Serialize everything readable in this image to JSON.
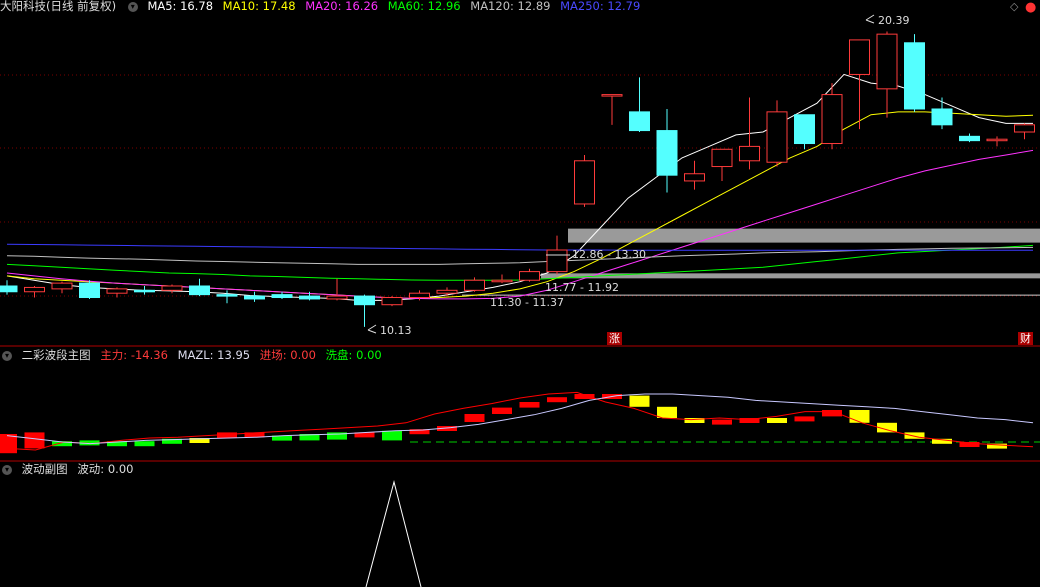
{
  "colors": {
    "up": "#ff3b3b",
    "down": "#54ffff",
    "ma5": "#ffffff",
    "ma10": "#ffff00",
    "ma20": "#ff33ff",
    "ma60": "#00ff00",
    "ma120": "#c0c0c0",
    "ma250": "#3b3bff",
    "grid": "#7a0000",
    "zone": "#9a9a9a",
    "sub_bull": "#ff0000",
    "sub_bear": "#ffff00",
    "sub_flat": "#00ff00",
    "mazl": "#c8c8ff"
  },
  "header": {
    "stock": "大阳科技(日线 前复权)",
    "ma5": "MA5: 16.78",
    "ma10": "MA10: 17.48",
    "ma20": "MA20: 16.26",
    "ma60": "MA60: 12.96",
    "ma120": "MA120: 12.89",
    "ma250": "MA250: 12.79"
  },
  "panel2": {
    "title": "二彩波段主图",
    "zhuli": "主力: -14.36",
    "mazl": "MAZL: 13.95",
    "jinchang": "进场: 0.00",
    "xipan": "洗盘: 0.00"
  },
  "panel3": {
    "title": "波动副图",
    "bodong": "波动: 0.00"
  },
  "markers": {
    "zhang": "涨",
    "cai": "财"
  },
  "chart_data": [
    {
      "type": "candlestick",
      "title": "大阳科技(日线 前复权)",
      "ylim": [
        9.5,
        21.0
      ],
      "annotations": {
        "high": "20.39",
        "low": "10.13",
        "zones": [
          "12.86 - 13.30",
          "11.77 - 11.92",
          "11.30 - 11.37"
        ]
      },
      "candles": [
        {
          "o": 11.55,
          "h": 11.75,
          "l": 11.25,
          "c": 11.35
        },
        {
          "o": 11.35,
          "h": 11.55,
          "l": 11.15,
          "c": 11.5
        },
        {
          "o": 11.45,
          "h": 11.7,
          "l": 11.3,
          "c": 11.65
        },
        {
          "o": 11.65,
          "h": 11.75,
          "l": 11.1,
          "c": 11.15
        },
        {
          "o": 11.3,
          "h": 11.5,
          "l": 11.15,
          "c": 11.45
        },
        {
          "o": 11.4,
          "h": 11.55,
          "l": 11.25,
          "c": 11.38
        },
        {
          "o": 11.4,
          "h": 11.6,
          "l": 11.3,
          "c": 11.55
        },
        {
          "o": 11.55,
          "h": 11.8,
          "l": 11.2,
          "c": 11.25
        },
        {
          "o": 11.25,
          "h": 11.4,
          "l": 10.95,
          "c": 11.2
        },
        {
          "o": 11.2,
          "h": 11.35,
          "l": 11.0,
          "c": 11.1
        },
        {
          "o": 11.25,
          "h": 11.35,
          "l": 11.1,
          "c": 11.15
        },
        {
          "o": 11.2,
          "h": 11.35,
          "l": 11.05,
          "c": 11.1
        },
        {
          "o": 11.1,
          "h": 11.8,
          "l": 11.05,
          "c": 11.2
        },
        {
          "o": 11.2,
          "h": 11.25,
          "l": 10.13,
          "c": 10.9
        },
        {
          "o": 10.9,
          "h": 11.2,
          "l": 10.85,
          "c": 11.15
        },
        {
          "o": 11.15,
          "h": 11.4,
          "l": 11.05,
          "c": 11.3
        },
        {
          "o": 11.3,
          "h": 11.5,
          "l": 11.2,
          "c": 11.4
        },
        {
          "o": 11.4,
          "h": 11.85,
          "l": 11.35,
          "c": 11.75
        },
        {
          "o": 11.7,
          "h": 11.95,
          "l": 11.65,
          "c": 11.75
        },
        {
          "o": 11.75,
          "h": 12.15,
          "l": 11.7,
          "c": 12.05
        },
        {
          "o": 12.05,
          "h": 13.3,
          "l": 11.95,
          "c": 12.8
        },
        {
          "o": 14.4,
          "h": 16.1,
          "l": 14.3,
          "c": 15.9
        },
        {
          "o": 18.2,
          "h": 18.2,
          "l": 17.15,
          "c": 18.2
        },
        {
          "o": 17.6,
          "h": 18.8,
          "l": 16.9,
          "c": 16.95
        },
        {
          "o": 16.95,
          "h": 17.7,
          "l": 14.8,
          "c": 15.4
        },
        {
          "o": 15.2,
          "h": 15.9,
          "l": 14.9,
          "c": 15.45
        },
        {
          "o": 15.7,
          "h": 16.3,
          "l": 15.2,
          "c": 16.3
        },
        {
          "o": 15.9,
          "h": 18.1,
          "l": 15.6,
          "c": 16.4
        },
        {
          "o": 15.85,
          "h": 18.0,
          "l": 15.7,
          "c": 17.6
        },
        {
          "o": 17.5,
          "h": 17.5,
          "l": 16.3,
          "c": 16.5
        },
        {
          "o": 16.5,
          "h": 18.6,
          "l": 16.3,
          "c": 18.2
        },
        {
          "o": 18.9,
          "h": 19.7,
          "l": 17.0,
          "c": 20.1
        },
        {
          "o": 18.4,
          "h": 20.39,
          "l": 17.4,
          "c": 20.3
        },
        {
          "o": 20.0,
          "h": 20.3,
          "l": 17.6,
          "c": 17.7
        },
        {
          "o": 17.7,
          "h": 18.1,
          "l": 17.0,
          "c": 17.15
        },
        {
          "o": 16.75,
          "h": 16.85,
          "l": 16.55,
          "c": 16.6
        },
        {
          "o": 16.6,
          "h": 16.75,
          "l": 16.4,
          "c": 16.65
        },
        {
          "o": 16.9,
          "h": 17.2,
          "l": 16.65,
          "c": 17.15
        },
        {
          "o": 17.2,
          "h": 17.5,
          "l": 16.6,
          "c": 16.8
        }
      ],
      "ma_lines": {
        "ma5": [
          11.9,
          11.75,
          11.6,
          11.5,
          11.45,
          11.4,
          11.38,
          11.35,
          11.3,
          11.22,
          11.18,
          11.15,
          11.12,
          11.05,
          11.05,
          11.1,
          11.2,
          11.35,
          11.5,
          11.7,
          12.0,
          12.6,
          13.6,
          14.6,
          15.3,
          16.0,
          16.4,
          16.8,
          16.9,
          17.4,
          17.9,
          18.9,
          18.6,
          18.5,
          18.2,
          17.8,
          17.4,
          17.2,
          17.2
        ],
        "ma10": [
          11.9,
          11.8,
          11.75,
          11.7,
          11.65,
          11.6,
          11.55,
          11.5,
          11.45,
          11.4,
          11.35,
          11.3,
          11.25,
          11.2,
          11.15,
          11.12,
          11.15,
          11.2,
          11.3,
          11.45,
          11.7,
          12.05,
          12.5,
          13.0,
          13.5,
          14.0,
          14.5,
          15.0,
          15.5,
          16.0,
          16.4,
          17.0,
          17.5,
          17.6,
          17.6,
          17.55,
          17.5,
          17.45,
          17.48
        ],
        "ma20": [
          12.0,
          11.9,
          11.8,
          11.72,
          11.65,
          11.6,
          11.55,
          11.5,
          11.45,
          11.4,
          11.35,
          11.3,
          11.25,
          11.2,
          11.15,
          11.12,
          11.1,
          11.1,
          11.12,
          11.2,
          11.4,
          11.7,
          12.0,
          12.3,
          12.6,
          12.9,
          13.2,
          13.5,
          13.8,
          14.1,
          14.4,
          14.7,
          15.0,
          15.3,
          15.55,
          15.75,
          15.95,
          16.1,
          16.26
        ],
        "ma60": [
          12.3,
          12.25,
          12.2,
          12.15,
          12.1,
          12.05,
          12.0,
          11.98,
          11.95,
          11.9,
          11.88,
          11.85,
          11.82,
          11.8,
          11.78,
          11.76,
          11.75,
          11.75,
          11.75,
          11.76,
          11.8,
          11.85,
          11.9,
          11.95,
          12.0,
          12.05,
          12.1,
          12.15,
          12.2,
          12.3,
          12.4,
          12.5,
          12.6,
          12.7,
          12.75,
          12.8,
          12.85,
          12.9,
          12.96
        ],
        "ma120": [
          12.6,
          12.58,
          12.55,
          12.52,
          12.5,
          12.48,
          12.45,
          12.42,
          12.4,
          12.38,
          12.36,
          12.34,
          12.32,
          12.3,
          12.3,
          12.3,
          12.3,
          12.32,
          12.34,
          12.36,
          12.4,
          12.44,
          12.48,
          12.52,
          12.56,
          12.6,
          12.63,
          12.66,
          12.7,
          12.72,
          12.74,
          12.77,
          12.8,
          12.82,
          12.84,
          12.86,
          12.87,
          12.88,
          12.89
        ],
        "ma250": [
          13.0,
          12.99,
          12.98,
          12.97,
          12.96,
          12.95,
          12.94,
          12.93,
          12.92,
          12.91,
          12.9,
          12.89,
          12.88,
          12.87,
          12.86,
          12.85,
          12.84,
          12.83,
          12.82,
          12.81,
          12.8,
          12.8,
          12.8,
          12.79,
          12.79,
          12.79,
          12.79,
          12.79,
          12.79,
          12.79,
          12.79,
          12.79,
          12.79,
          12.79,
          12.79,
          12.79,
          12.79,
          12.79,
          12.79
        ]
      }
    },
    {
      "type": "bar",
      "title": "二彩波段主图",
      "ylim": [
        -20,
        100
      ],
      "bars": [
        {
          "v": [
            -14,
            10
          ],
          "c": "up"
        },
        {
          "v": [
            -8,
            12
          ],
          "c": "up"
        },
        {
          "v": [
            -5,
            1
          ],
          "c": "flat"
        },
        {
          "v": [
            -3,
            2
          ],
          "c": "flat"
        },
        {
          "v": [
            0,
            1
          ],
          "c": "flat"
        },
        {
          "v": [
            0,
            1
          ],
          "c": "flat"
        },
        {
          "v": [
            4,
            1
          ],
          "c": "flat"
        },
        {
          "v": [
            5,
            -1
          ],
          "c": "bear"
        },
        {
          "v": [
            5,
            12
          ],
          "c": "up"
        },
        {
          "v": [
            8,
            12
          ],
          "c": "up"
        },
        {
          "v": [
            8,
            6
          ],
          "c": "flat"
        },
        {
          "v": [
            10,
            2
          ],
          "c": "flat"
        },
        {
          "v": [
            12,
            3
          ],
          "c": "flat"
        },
        {
          "v": [
            12,
            10
          ],
          "c": "up"
        },
        {
          "v": [
            14,
            2
          ],
          "c": "flat"
        },
        {
          "v": [
            16,
            10
          ],
          "c": "up"
        },
        {
          "v": [
            20,
            18
          ],
          "c": "up"
        },
        {
          "v": [
            25,
            35
          ],
          "c": "up"
        },
        {
          "v": [
            35,
            43
          ],
          "c": "up"
        },
        {
          "v": [
            43,
            50
          ],
          "c": "up"
        },
        {
          "v": [
            50,
            56
          ],
          "c": "up"
        },
        {
          "v": [
            56,
            60
          ],
          "c": "up"
        },
        {
          "v": [
            60,
            58
          ],
          "c": "up"
        },
        {
          "v": [
            58,
            44
          ],
          "c": "bear"
        },
        {
          "v": [
            44,
            30
          ],
          "c": "bear"
        },
        {
          "v": [
            30,
            24
          ],
          "c": "bear"
        },
        {
          "v": [
            24,
            28
          ],
          "c": "up"
        },
        {
          "v": [
            28,
            30
          ],
          "c": "up"
        },
        {
          "v": [
            30,
            26
          ],
          "c": "bear"
        },
        {
          "v": [
            26,
            32
          ],
          "c": "up"
        },
        {
          "v": [
            32,
            40
          ],
          "c": "up"
        },
        {
          "v": [
            40,
            24
          ],
          "c": "bear"
        },
        {
          "v": [
            24,
            12
          ],
          "c": "bear"
        },
        {
          "v": [
            12,
            4
          ],
          "c": "bear"
        },
        {
          "v": [
            4,
            0
          ],
          "c": "bear"
        },
        {
          "v": [
            0,
            -2
          ],
          "c": "up"
        },
        {
          "v": [
            -2,
            -4
          ],
          "c": "bear"
        }
      ],
      "mainline": [
        -8,
        -10,
        0,
        -2,
        2,
        5,
        6,
        8,
        10,
        12,
        14,
        16,
        18,
        20,
        24,
        35,
        42,
        48,
        55,
        60,
        62,
        50,
        42,
        30,
        28,
        30,
        28,
        32,
        38,
        38,
        24,
        14,
        6,
        2,
        -2,
        -4,
        -6
      ],
      "mazl": [
        8,
        4,
        0,
        -2,
        0,
        2,
        3,
        4,
        5,
        6,
        8,
        9,
        10,
        12,
        14,
        15,
        18,
        22,
        28,
        34,
        42,
        52,
        58,
        60,
        60,
        58,
        56,
        52,
        50,
        48,
        46,
        44,
        42,
        38,
        34,
        30,
        28,
        24
      ]
    },
    {
      "type": "line",
      "title": "波动副图",
      "values": [
        0,
        100,
        0
      ]
    }
  ]
}
